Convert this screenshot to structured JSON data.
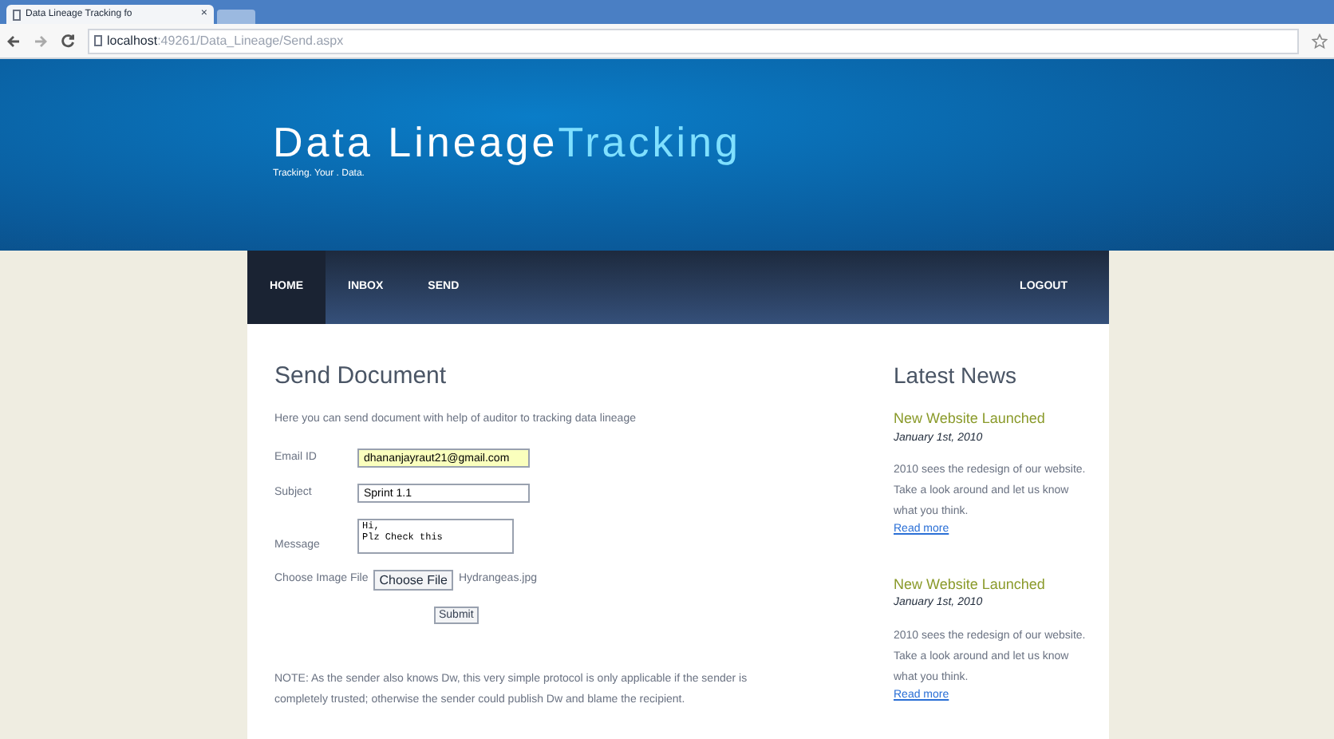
{
  "browser": {
    "tab_title": "Data Lineage Tracking fo",
    "tab_close": "×",
    "url_host": "localhost",
    "url_path": ":49261/Data_Lineage/Send.aspx"
  },
  "header": {
    "title_main": "Data Lineage",
    "title_accent": "Tracking",
    "tagline": "Tracking. Your . Data."
  },
  "nav": {
    "items": [
      {
        "label": "HOME",
        "selected": true
      },
      {
        "label": "INBOX",
        "selected": false
      },
      {
        "label": "SEND",
        "selected": false
      }
    ],
    "logout": "LOGOUT"
  },
  "form": {
    "heading": "Send Document",
    "intro": "Here you can send document with help of auditor to tracking data lineage",
    "fields": [
      {
        "kind": "input",
        "label": "Email ID",
        "value": "dhananjayraut21@gmail.com",
        "autofilled": true
      },
      {
        "kind": "input",
        "label": "Subject",
        "value": "Sprint 1.1"
      },
      {
        "kind": "textarea",
        "label": "Message",
        "value": "Hi,\nPlz Check this"
      },
      {
        "kind": "file",
        "label": "Choose Image File",
        "button": "Choose File",
        "value": "Hydrangeas.jpg"
      }
    ],
    "submit": "Submit",
    "note": "NOTE: As the sender also knows Dw, this very simple protocol is only applicable if the sender is completely trusted; otherwise the sender could publish Dw and blame the recipient."
  },
  "news": {
    "heading": "Latest News",
    "items": [
      {
        "title": "New Website Launched",
        "date": "January 1st, 2010",
        "body": "2010 sees the redesign of our website. Take a look around and let us know what you think.",
        "link": "Read more"
      },
      {
        "title": "New Website Launched",
        "date": "January 1st, 2010",
        "body": "2010 sees the redesign of our website. Take a look around and let us know what you think.",
        "link": "Read more"
      }
    ]
  }
}
